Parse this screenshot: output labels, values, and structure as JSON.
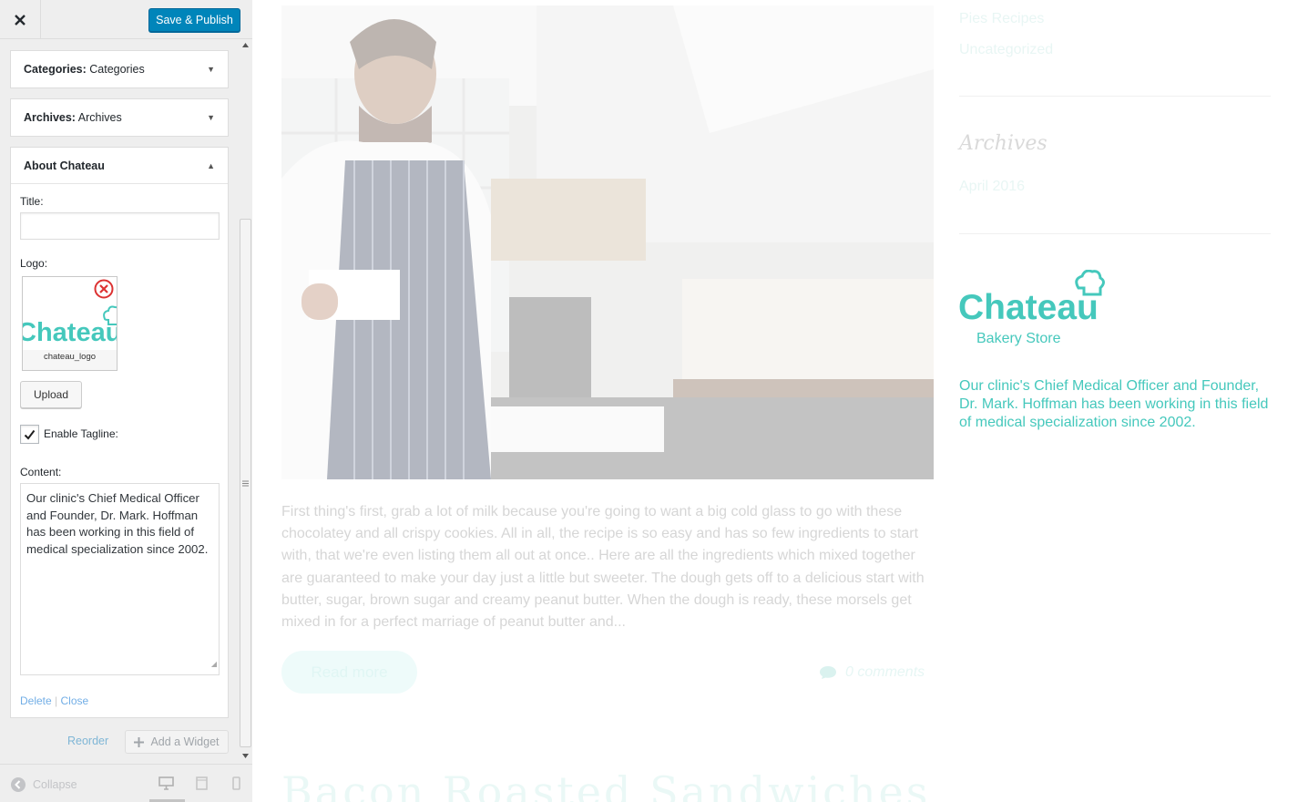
{
  "header": {
    "close_label": "×",
    "save_label": "Save & Publish"
  },
  "sections": {
    "categories": {
      "key": "Categories:",
      "value": " Categories"
    },
    "archives": {
      "key": "Archives:",
      "value": " Archives"
    },
    "about": {
      "title": "About Chateau"
    }
  },
  "form": {
    "title_label": "Title:",
    "title_value": "",
    "logo_label": "Logo:",
    "logo_filename": "chateau_logo",
    "upload_label": "Upload",
    "tagline_label": "Enable Tagline:",
    "tagline_checked": true,
    "content_label": "Content:",
    "content_value": "Our clinic's Chief Medical Officer and Founder, Dr. Mark. Hoffman has been working in this field of medical specialization since 2002.",
    "delete_label": "Delete",
    "separator": " | ",
    "close_label": "Close"
  },
  "panel_actions": {
    "reorder_label": "Reorder",
    "add_widget_label": "Add a Widget"
  },
  "footer": {
    "collapse_label": "Collapse",
    "devices": [
      "desktop-icon",
      "tablet-icon",
      "mobile-icon"
    ]
  },
  "preview": {
    "excerpt": "First thing's first, grab a lot of milk because you're going to want a big cold glass to go with these chocolatey and all crispy cookies. All in all, the recipe is so easy and has so few ingredients to start with, that we're even listing them all out at once.. Here are all the ingredients which mixed together are guaranteed to make your day just a little but sweeter. The dough gets off to a delicious start with butter, sugar, brown sugar and creamy peanut butter. When the dough is ready, these morsels get mixed in for a perfect marriage of peanut butter and...",
    "read_more": "Read more",
    "comments": "0 comments",
    "next_title": "Bacon Roasted Sandwiches",
    "sidebar": {
      "category_links": [
        "Pies Recipes",
        "Uncategorized"
      ],
      "archives_heading": "Archives",
      "archive_links": [
        "April 2016"
      ],
      "brand_name": "Chateau",
      "brand_tagline": "Bakery Store",
      "about_text": "Our clinic's Chief Medical Officer and Founder, Dr. Mark. Hoffman has been working in this field of medical specialization since 2002."
    }
  },
  "colors": {
    "accent": "#45c8bc",
    "wp_blue": "#0085ba",
    "link": "#0073aa",
    "remove": "#dc3232"
  }
}
